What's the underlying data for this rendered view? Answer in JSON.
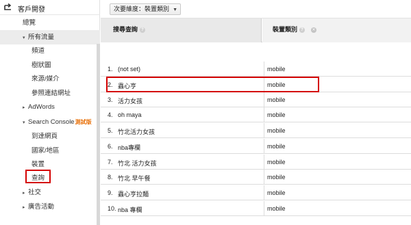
{
  "sidebar": {
    "section_title": "客戶開發",
    "items": [
      {
        "label": "總覽",
        "level": 1,
        "expand": "",
        "selected": false
      },
      {
        "label": "所有流量",
        "level": 1,
        "expand": "▾",
        "selected": true
      },
      {
        "label": "頻道",
        "level": 2,
        "expand": "",
        "selected": false
      },
      {
        "label": "樹狀圖",
        "level": 2,
        "expand": "",
        "selected": false
      },
      {
        "label": "來源/媒介",
        "level": 2,
        "expand": "",
        "selected": false
      },
      {
        "label": "參照連結網址",
        "level": 2,
        "expand": "",
        "selected": false
      },
      {
        "label": "AdWords",
        "level": 1,
        "expand": "▸",
        "selected": false
      },
      {
        "label": "Search Console",
        "level": 1,
        "expand": "▾",
        "selected": false,
        "badge": "測試版"
      },
      {
        "label": "到達網頁",
        "level": 2,
        "expand": "",
        "selected": false
      },
      {
        "label": "國家/地區",
        "level": 2,
        "expand": "",
        "selected": false
      },
      {
        "label": "裝置",
        "level": 2,
        "expand": "",
        "selected": false
      },
      {
        "label": "查詢",
        "level": 2,
        "expand": "",
        "selected": false
      },
      {
        "label": "社交",
        "level": 1,
        "expand": "▸",
        "selected": false
      },
      {
        "label": "廣告活動",
        "level": 1,
        "expand": "▸",
        "selected": false
      }
    ]
  },
  "toolbar": {
    "secondary_dimension_label": "次要維度：裝置類別"
  },
  "table": {
    "columns": [
      "搜尋查詢",
      "裝置類別"
    ],
    "rows": [
      {
        "num": "1.",
        "query": "(not set)",
        "device": "mobile"
      },
      {
        "num": "2.",
        "query": "蟲心亨",
        "device": "mobile"
      },
      {
        "num": "3.",
        "query": "活力女孩",
        "device": "mobile"
      },
      {
        "num": "4.",
        "query": "oh maya",
        "device": "mobile"
      },
      {
        "num": "5.",
        "query": "竹北活力女孩",
        "device": "mobile"
      },
      {
        "num": "6.",
        "query": "nba專欄",
        "device": "mobile"
      },
      {
        "num": "7.",
        "query": "竹北 活力女孩",
        "device": "mobile"
      },
      {
        "num": "8.",
        "query": "竹北 早午餐",
        "device": "mobile"
      },
      {
        "num": "9.",
        "query": "蟲心亨拉麵",
        "device": "mobile"
      },
      {
        "num": "10.",
        "query": "nba 專欄",
        "device": "mobile"
      }
    ]
  },
  "colors": {
    "highlight": "#d40000",
    "beta_badge": "#e8710a"
  }
}
